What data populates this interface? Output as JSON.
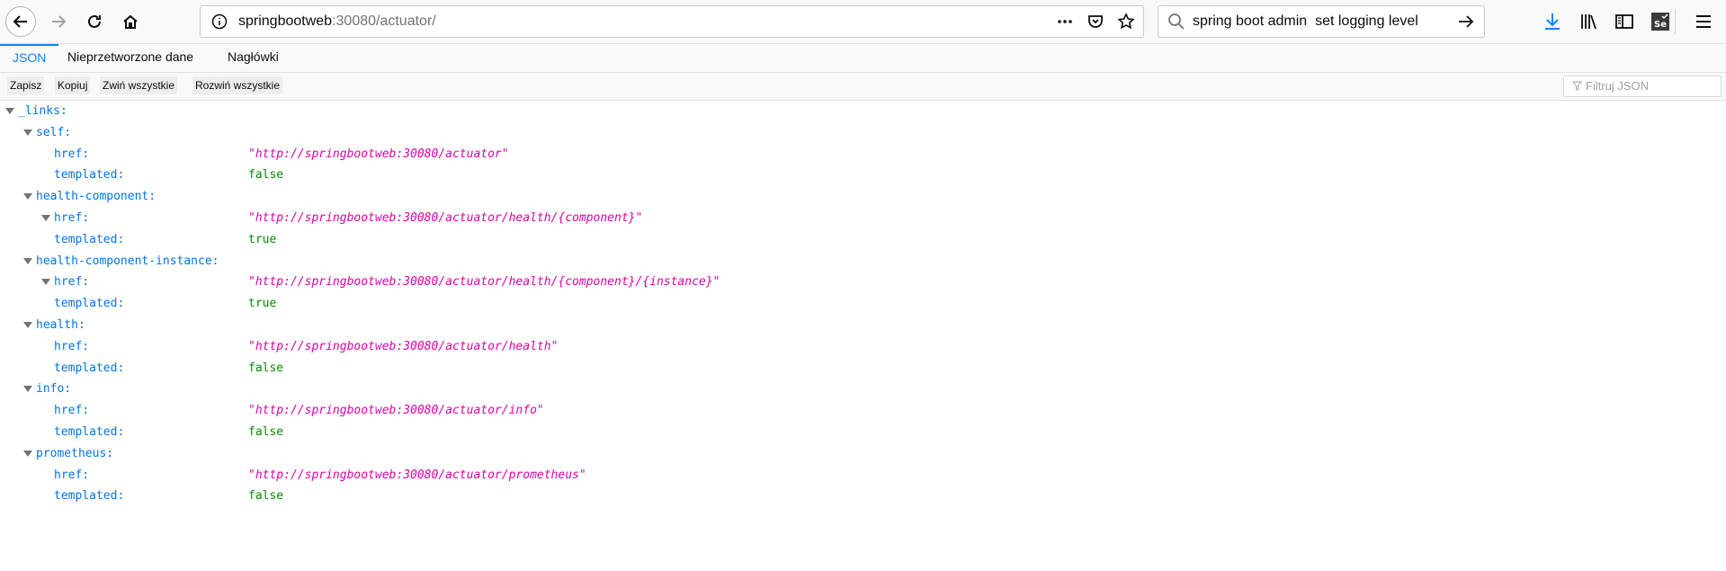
{
  "browser": {
    "url_host": "springbootweb",
    "url_rest": ":30080/actuator/",
    "search_text": "spring boot admin  set logging level",
    "nav_icons": [
      "back-arrow-icon",
      "forward-arrow-icon",
      "reload-icon",
      "home-icon"
    ],
    "url_action_icons": [
      "more-actions-icon",
      "pocket-icon",
      "bookmark-star-icon"
    ],
    "toolbar_icons": [
      "download-icon",
      "library-icon",
      "sidebar-icon",
      "selenium-ide-icon",
      "hamburger-menu-icon"
    ]
  },
  "viewer": {
    "tabs": [
      {
        "label": "JSON",
        "active": true
      },
      {
        "label": "Nieprzetworzone dane",
        "active": false
      },
      {
        "label": "Nagłówki",
        "active": false
      }
    ],
    "buttons": [
      "Zapisz",
      "Kopiuj",
      "Zwiń wszystkie",
      "Rozwiń wszystkie"
    ],
    "filter_placeholder": "Filtruj JSON"
  },
  "json_tree": {
    "root_key": "_links:",
    "groups": [
      {
        "key": "self:",
        "href": "http://springbootweb:30080/actuator",
        "href_expandable": false,
        "templated": "false"
      },
      {
        "key": "health-component:",
        "href": "http://springbootweb:30080/actuator/health/{component}",
        "href_expandable": true,
        "templated": "true"
      },
      {
        "key": "health-component-instance:",
        "href": "http://springbootweb:30080/actuator/health/{component}/{instance}",
        "href_expandable": true,
        "templated": "true"
      },
      {
        "key": "health:",
        "href": "http://springbootweb:30080/actuator/health",
        "href_expandable": false,
        "templated": "false"
      },
      {
        "key": "info:",
        "href": "http://springbootweb:30080/actuator/info",
        "href_expandable": false,
        "templated": "false"
      },
      {
        "key": "prometheus:",
        "href": "http://springbootweb:30080/actuator/prometheus",
        "href_expandable": false,
        "templated": "false"
      }
    ],
    "href_label": "href:",
    "templated_label": "templated:"
  },
  "colors": {
    "key": "#0074e8",
    "string": "#dd00a9",
    "boolean": "#058b00",
    "accent": "#0a84ff"
  }
}
